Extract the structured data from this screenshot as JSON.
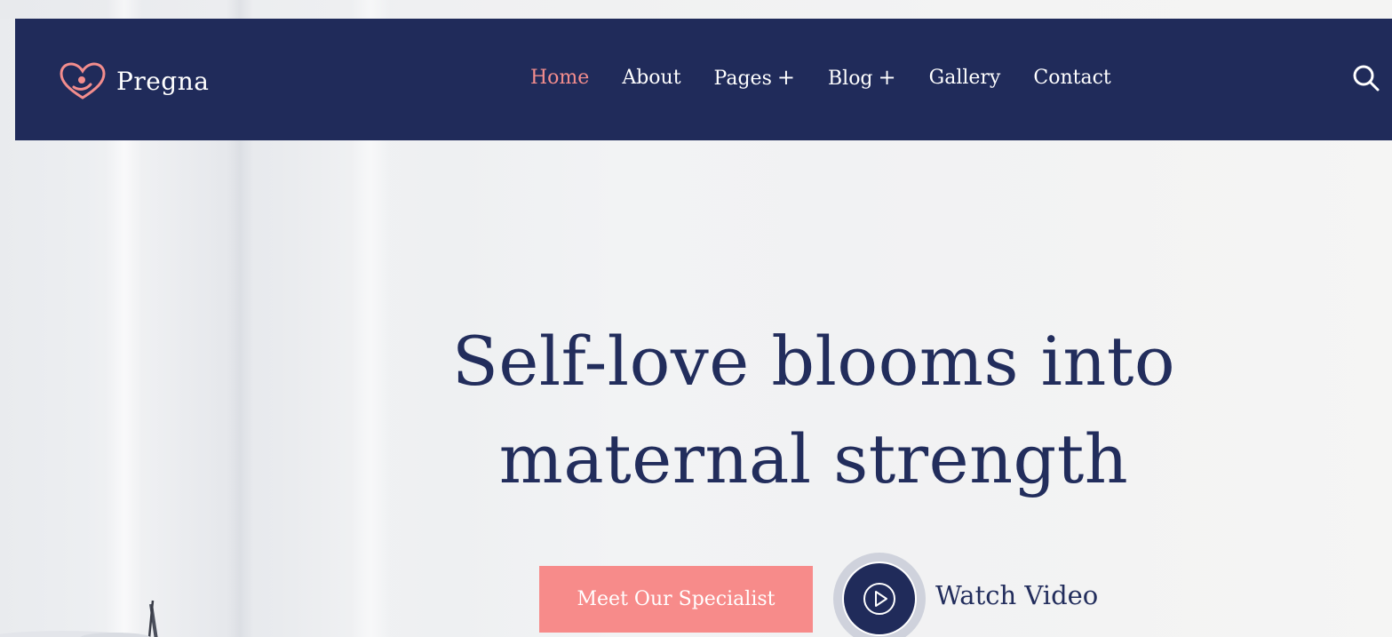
{
  "brand": {
    "name": "Pregna",
    "logo_icon": "heart-logo-icon",
    "accent_color": "#f38d8d"
  },
  "nav": {
    "background": "#202b5a",
    "items": [
      {
        "label": "Home",
        "active": true
      },
      {
        "label": "About",
        "active": false
      },
      {
        "label": "Pages",
        "has_submenu": true,
        "submenu_indicator": "+"
      },
      {
        "label": "Blog",
        "has_submenu": true,
        "submenu_indicator": "+"
      },
      {
        "label": "Gallery",
        "active": false
      },
      {
        "label": "Contact",
        "active": false
      }
    ],
    "search_icon": "search-icon"
  },
  "hero": {
    "title_line1": "Self-love blooms into",
    "title_line2": "maternal strength",
    "title_color": "#222d5c",
    "cta_label": "Meet Our Specialist",
    "cta_color": "#f78b8a",
    "video_label": "Watch Video",
    "play_icon": "play-icon"
  }
}
